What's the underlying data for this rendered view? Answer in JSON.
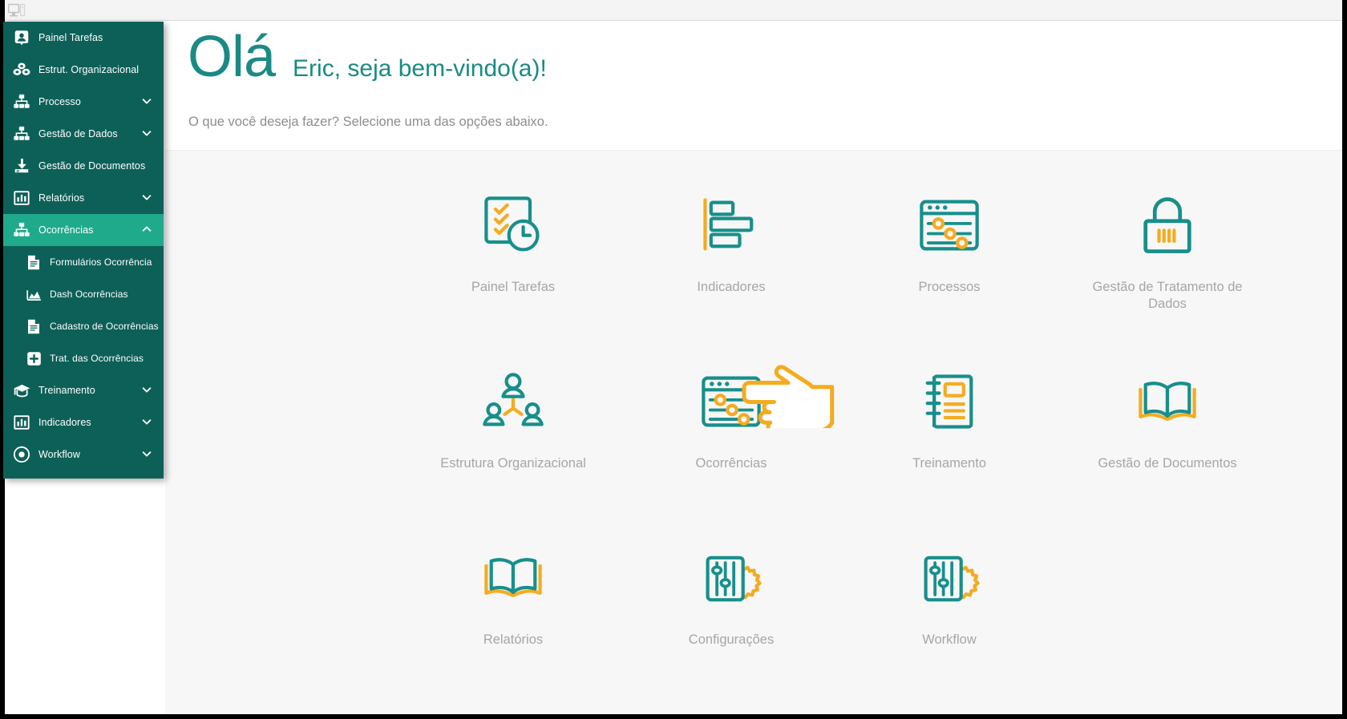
{
  "window": {
    "icon": "monitor-icon"
  },
  "sidebar": {
    "items": [
      {
        "label": "Painel Tarefas",
        "icon": "user-badge-icon",
        "chevron": "",
        "level": "top",
        "active": false
      },
      {
        "label": "Estrut. Organizacional",
        "icon": "blocks-icon",
        "chevron": "",
        "level": "top",
        "active": false
      },
      {
        "label": "Processo",
        "icon": "hierarchy-icon",
        "chevron": "down",
        "level": "top",
        "active": false
      },
      {
        "label": "Gestão de Dados",
        "icon": "hierarchy-icon",
        "chevron": "down",
        "level": "top",
        "active": false
      },
      {
        "label": "Gestão de Documentos",
        "icon": "download-icon",
        "chevron": "",
        "level": "top",
        "active": false
      },
      {
        "label": "Relatórios",
        "icon": "bar-chart-icon",
        "chevron": "down",
        "level": "top",
        "active": false
      },
      {
        "label": "Ocorrências",
        "icon": "hierarchy-icon",
        "chevron": "up",
        "level": "top",
        "active": true
      },
      {
        "label": "Formulários Ocorrência",
        "icon": "document-icon",
        "chevron": "",
        "level": "sub",
        "active": false
      },
      {
        "label": "Dash Ocorrências",
        "icon": "area-chart-icon",
        "chevron": "",
        "level": "sub",
        "active": false
      },
      {
        "label": "Cadastro de Ocorrências",
        "icon": "document-icon",
        "chevron": "",
        "level": "sub",
        "active": false
      },
      {
        "label": "Trat. das Ocorrências",
        "icon": "plus-square-icon",
        "chevron": "",
        "level": "sub",
        "active": false
      },
      {
        "label": "Treinamento",
        "icon": "graduation-icon",
        "chevron": "down",
        "level": "top",
        "active": false
      },
      {
        "label": "Indicadores",
        "icon": "bar-chart-icon",
        "chevron": "down",
        "level": "top",
        "active": false
      },
      {
        "label": "Workflow",
        "icon": "target-icon",
        "chevron": "down",
        "level": "top",
        "active": false
      }
    ]
  },
  "header": {
    "greeting": "Olá",
    "welcome": "Eric, seja bem-vindo(a)!",
    "subtitle": "O que você deseja fazer? Selecione uma das opções abaixo."
  },
  "tiles": [
    [
      {
        "label": "Painel Tarefas",
        "icon": "checklist-clock-icon"
      },
      {
        "label": "Indicadores",
        "icon": "horizontal-bar-chart-icon"
      },
      {
        "label": "Processos",
        "icon": "window-sliders-icon"
      },
      {
        "label": "Gestão de Tratamento de Dados",
        "icon": "padlock-icon"
      }
    ],
    [
      {
        "label": "Estrutura Organizacional",
        "icon": "org-chart-people-icon"
      },
      {
        "label": "Ocorrências",
        "icon": "window-sliders-icon"
      },
      {
        "label": "Treinamento",
        "icon": "notebook-icon"
      },
      {
        "label": "Gestão de Documentos",
        "icon": "open-book-icon"
      }
    ],
    [
      {
        "label": "Relatórios",
        "icon": "open-book-icon"
      },
      {
        "label": "Configurações",
        "icon": "sliders-gear-icon"
      },
      {
        "label": "Workflow",
        "icon": "sliders-gear-icon"
      },
      {
        "label": "",
        "icon": ""
      }
    ]
  ],
  "cursor": {
    "name": "pointing-hand-cursor",
    "points_at": "Ocorrências"
  },
  "colors": {
    "sidebar_bg": "#0d6058",
    "sidebar_active": "#1faa8c",
    "teal": "#1a8a85",
    "icon_teal": "#178f8c",
    "icon_yellow": "#f5ab20",
    "label_grey": "#a6a6a6",
    "content_bg": "#f7f7f7"
  }
}
